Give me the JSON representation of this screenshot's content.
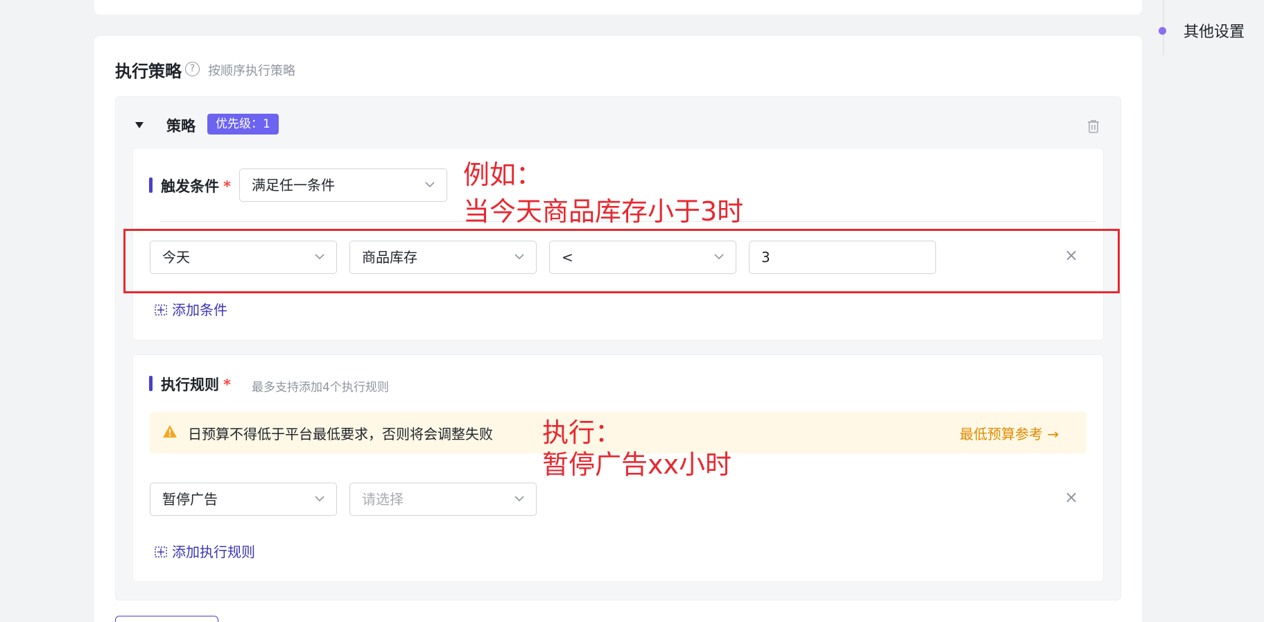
{
  "anchor_nav": {
    "items": [
      "其他设置"
    ]
  },
  "section": {
    "title": "执行策略",
    "help_glyph": "?",
    "hint": "按顺序执行策略"
  },
  "strategy": {
    "label": "策略",
    "priority_badge": "优先级：1"
  },
  "trigger": {
    "label": "触发条件",
    "required_mark": "*",
    "match_mode": "满足任一条件",
    "condition": {
      "time": "今天",
      "metric": "商品库存",
      "operator": "<",
      "value": "3"
    },
    "add_label": "添加条件"
  },
  "rules": {
    "label": "执行规则",
    "required_mark": "*",
    "hint": "最多支持添加4个执行规则",
    "warning": {
      "text": "日预算不得低于平台最低要求，否则将会调整失败",
      "link": "最低预算参考 →"
    },
    "rule": {
      "action": "暂停广告",
      "option_placeholder": "请选择"
    },
    "add_label": "添加执行规则"
  },
  "annotations": {
    "trigger_line1": "例如：",
    "trigger_line2": "当今天商品库存小于3时",
    "action_line1": "执行：",
    "action_line2": "暂停广告xx小时"
  },
  "colors": {
    "accent": "#4a3fd0",
    "badge": "#6c63f0",
    "annotation_red": "#e8282f",
    "warning_orange": "#e08a00",
    "warning_bg": "#fff8e6"
  }
}
